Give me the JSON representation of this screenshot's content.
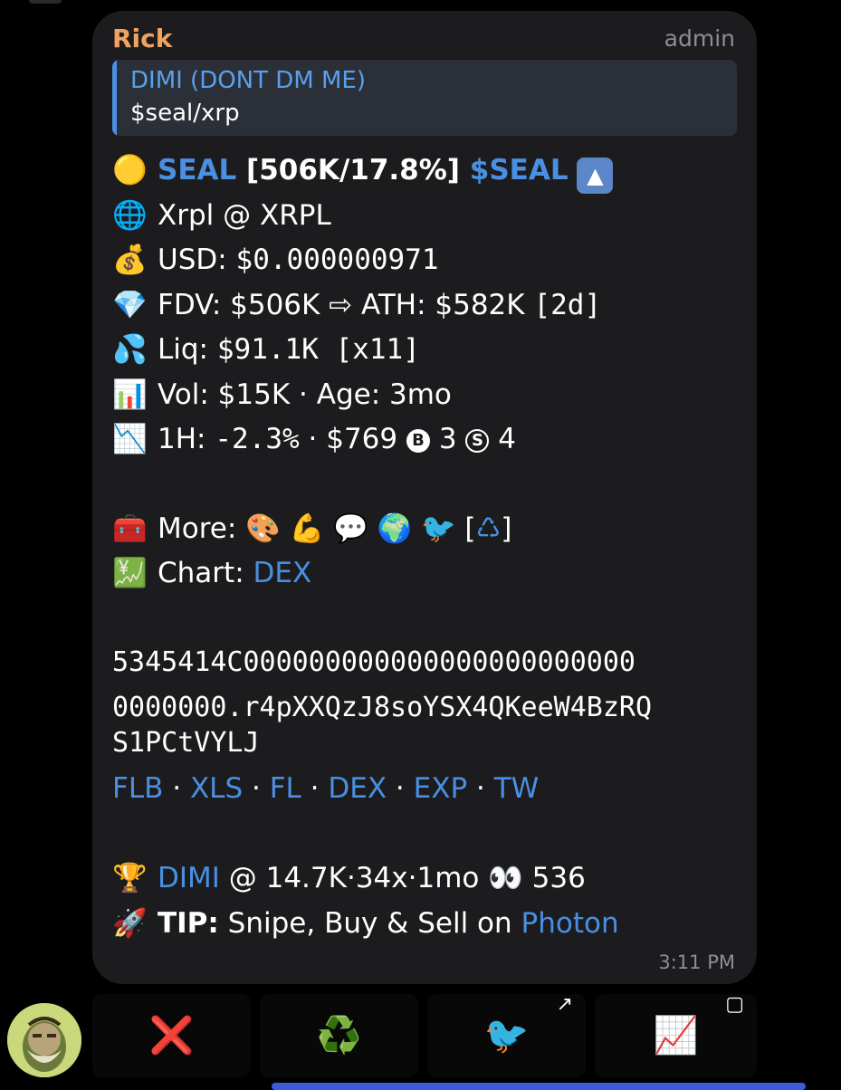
{
  "message": {
    "sender": "Rick",
    "role": "admin",
    "reply": {
      "name": "DIMI (DONT DM ME)",
      "text": "$seal/xrp"
    },
    "token_line": {
      "icon": "🟡",
      "name": "SEAL",
      "stats": " [506K/17.8%] ",
      "ticker": "$SEAL",
      "arrow": "▲"
    },
    "chain_line": {
      "icon": "🌐",
      "text": "Xrpl @ XRPL"
    },
    "usd_line": {
      "icon": "💰",
      "label": "USD: ",
      "value": "$0.000000971"
    },
    "fdv_line": {
      "icon": "💎",
      "text": "FDV: $506K ⇨ ATH: $582K ",
      "suffix": "[2d]"
    },
    "liq_line": {
      "icon": "💦",
      "label": "Liq: ",
      "value": "$91.1K [x11]"
    },
    "vol_line": {
      "icon": "📊",
      "text": "Vol: $15K · Age: 3mo"
    },
    "change_line": {
      "icon": "📉",
      "text": "1H: ",
      "value": "-2.3%",
      "rest": " · $769 ",
      "buy_badge": "B",
      "buys": " 3 ",
      "sell_badge": "S",
      "sells": " 4"
    },
    "more_line": {
      "icon": "🧰",
      "label": "More: ",
      "emojis": "🎨 💪 💬 🌍 🐦",
      "bracket_open": " [",
      "recycle": "♺",
      "bracket_close": "]"
    },
    "chart_line": {
      "icon": "💹",
      "label": "Chart: ",
      "link": "DEX"
    },
    "address": [
      "5345414C000000000000000000000000",
      "0000000.r4pXXQzJ8soYSX4QKeeW4BzRQ",
      "S1PCtVYLJ"
    ],
    "links": [
      "FLB",
      "XLS",
      "FL",
      "DEX",
      "EXP",
      "TW"
    ],
    "separator": " · ",
    "caller_line": {
      "icon": "🏆",
      "name": "DIMI",
      "text": " @ 14.7K·34x·1mo 👀 536"
    },
    "tip_line": {
      "icon": "🚀",
      "label": "TIP:",
      "text": " Snipe, Buy & Sell on ",
      "link": "Photon"
    },
    "time": "3:11 PM"
  },
  "keyboard": {
    "buttons": [
      {
        "emoji": "❌",
        "name": "close"
      },
      {
        "emoji": "♻️",
        "name": "refresh"
      },
      {
        "emoji": "🐦",
        "name": "bird",
        "corner": "↗"
      },
      {
        "emoji": "📈",
        "name": "chart",
        "corner": "▢"
      }
    ]
  }
}
